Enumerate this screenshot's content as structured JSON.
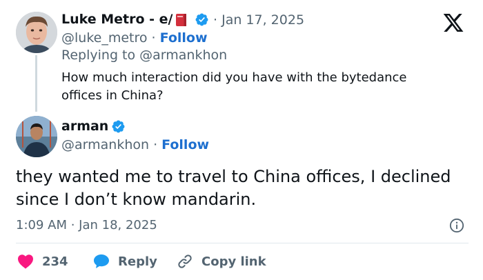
{
  "parent_tweet": {
    "name": "Luke Metro - e/",
    "book_emoji": "red-book-emoji",
    "date": "Jan 17, 2025",
    "handle": "@luke_metro",
    "follow_label": "Follow",
    "replying_to": "Replying to @armankhon",
    "text": "How much interaction did you have with the bytedance offices in China?"
  },
  "main_tweet": {
    "name": "arman",
    "handle": "@armankhon",
    "follow_label": "Follow",
    "text": "they wanted me to travel to China offices, I declined since I don’t know mandarin.",
    "timestamp": "1:09 AM · Jan 18, 2025"
  },
  "actions": {
    "like_count": "234",
    "reply_label": "Reply",
    "copy_label": "Copy link"
  },
  "icons": {
    "brand": "x-logo-icon",
    "verified": "verified-badge-icon",
    "info": "info-icon",
    "like": "heart-icon",
    "reply": "speech-bubble-icon",
    "copy": "link-icon"
  },
  "colors": {
    "verified": "#1d9bf0",
    "follow": "#1d6fcf",
    "like": "#f91880",
    "reply": "#1d9bf0",
    "secondary_text": "#536471",
    "primary_text": "#0f1419"
  }
}
